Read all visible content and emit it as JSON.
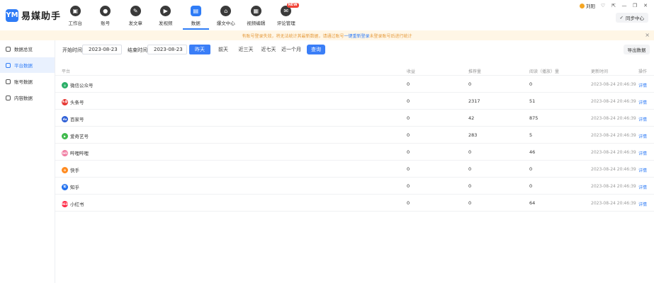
{
  "app": {
    "logo_mark": "YM",
    "name": "易媒助手"
  },
  "nav": [
    {
      "label": "工作台",
      "icon": "workbench-icon",
      "glyph": "▣"
    },
    {
      "label": "账号",
      "icon": "account-icon",
      "glyph": "●"
    },
    {
      "label": "发文章",
      "icon": "compose-icon",
      "glyph": "✎"
    },
    {
      "label": "发视频",
      "icon": "video-play-icon",
      "glyph": "▶"
    },
    {
      "label": "数据",
      "icon": "data-icon",
      "glyph": "▤"
    },
    {
      "label": "爆文中心",
      "icon": "home-icon",
      "glyph": "⌂"
    },
    {
      "label": "视频编辑",
      "icon": "video-edit-icon",
      "glyph": "▦"
    },
    {
      "label": "评论管理",
      "icon": "comment-icon",
      "glyph": "✉",
      "badge": "NEW"
    }
  ],
  "user": {
    "name": "刘阳"
  },
  "window_controls": [
    "♡",
    "⇱",
    "—",
    "❐",
    "✕"
  ],
  "sync_button": "同步中心",
  "notice": {
    "text": "有账号登录失效，将无法统计其最新数据，请通过账号",
    "link": "一键重新登录",
    "tail": "未登录账号后进行统计"
  },
  "sidebar": [
    {
      "label": "数据总览"
    },
    {
      "label": "平台数据"
    },
    {
      "label": "账号数据"
    },
    {
      "label": "内容数据"
    }
  ],
  "filter": {
    "start_label": "开始时间",
    "start_date": "2023-08-23",
    "end_label": "结束时间",
    "end_date": "2023-08-23",
    "quick": [
      "昨天",
      "前天",
      "近三天",
      "近七天",
      "近一个月"
    ],
    "query": "查询",
    "export": "导出数据"
  },
  "table": {
    "headers": [
      "平台",
      "收益",
      "推荐量",
      "阅读（播放）量",
      "更新时间",
      "操作"
    ],
    "rows": [
      {
        "platform": "微信公众号",
        "color": "#2aae67",
        "abbr": "◎",
        "income": "0",
        "recommend": "0",
        "read": "0",
        "time": "2023-08-24 20:46:39",
        "op": "详情"
      },
      {
        "platform": "头条号",
        "color": "#e5322d",
        "abbr": "头条",
        "income": "0",
        "recommend": "2317",
        "read": "51",
        "time": "2023-08-24 20:46:39",
        "op": "详情"
      },
      {
        "platform": "百家号",
        "color": "#2c5ed6",
        "abbr": "du",
        "income": "0",
        "recommend": "42",
        "read": "875",
        "time": "2023-08-24 20:46:39",
        "op": "详情"
      },
      {
        "platform": "爱奇艺号",
        "color": "#3fba4c",
        "abbr": "▶",
        "income": "0",
        "recommend": "283",
        "read": "5",
        "time": "2023-08-24 20:46:39",
        "op": "详情"
      },
      {
        "platform": "哔哩哔哩",
        "color": "#f07aa0",
        "abbr": "bili",
        "income": "0",
        "recommend": "0",
        "read": "46",
        "time": "2023-08-24 20:46:39",
        "op": "详情"
      },
      {
        "platform": "快手",
        "color": "#ff8a1f",
        "abbr": "✿",
        "income": "0",
        "recommend": "0",
        "read": "0",
        "time": "2023-08-24 20:46:39",
        "op": "详情"
      },
      {
        "platform": "知乎",
        "color": "#1e6fef",
        "abbr": "知",
        "income": "0",
        "recommend": "0",
        "read": "0",
        "time": "2023-08-24 20:46:39",
        "op": "详情"
      },
      {
        "platform": "小红书",
        "color": "#ff2442",
        "abbr": "RED",
        "income": "0",
        "recommend": "0",
        "read": "64",
        "time": "2023-08-24 20:46:39",
        "op": "详情"
      }
    ]
  },
  "colors": {
    "accent": "#2f7cf6",
    "notice_bg": "#fff6e6",
    "notice_text": "#e59a3a"
  }
}
